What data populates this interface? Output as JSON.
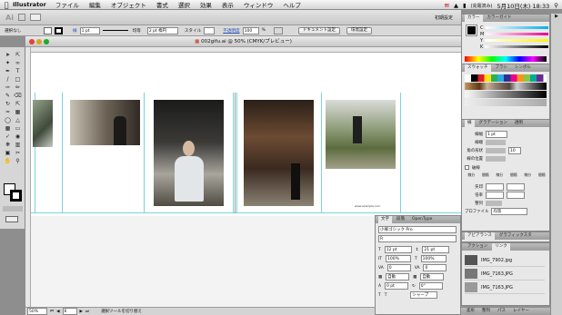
{
  "menubar": {
    "app": "Illustrator",
    "items": [
      "ファイル",
      "編集",
      "オブジェクト",
      "書式",
      "選択",
      "効果",
      "表示",
      "ウィンドウ",
      "ヘルプ"
    ],
    "status": "(充電済み)",
    "date": "5月10日(木) 18:33"
  },
  "appbar": {
    "logo": "Ai",
    "workspace": "初期設定"
  },
  "ctrlbar": {
    "selection": "選択なし",
    "stroke_label": "線",
    "stroke_value": "1 pt",
    "profile": "均等",
    "brush": "2 pt 楕円",
    "style_label": "スタイル",
    "opacity_label": "不透明度",
    "opacity_value": "100",
    "unit": "%",
    "doc_settings": "ドキュメント設定",
    "env_settings": "環境設定"
  },
  "document": {
    "title": "002gifu.ai @ 50% (CMYK/プレビュー)"
  },
  "canvas": {
    "footer_text": "www.example.com"
  },
  "status": {
    "zoom": "50%",
    "page": "6",
    "tool": "選択ツールを切り替え"
  },
  "color_panel": {
    "tabs": [
      "カラー",
      "カラーガイド"
    ],
    "channels": [
      "C",
      "M",
      "Y",
      "K"
    ]
  },
  "swatch_panel": {
    "tabs": [
      "スウォッチ",
      "ブラシ",
      "シンボル"
    ]
  },
  "stroke_panel": {
    "tabs": [
      "線",
      "グラデーション",
      "透明"
    ],
    "labels": [
      "線幅",
      "線端",
      "角の形状",
      "線の位置",
      "破線"
    ],
    "width": "1 pt",
    "limit": "10",
    "dash_labels": [
      "線分",
      "間隔",
      "線分",
      "間隔",
      "線分",
      "間隔"
    ],
    "arrow_labels": [
      "矢印",
      "倍率",
      "整列"
    ],
    "profile_label": "プロファイル",
    "profile_value": "均等"
  },
  "type_panel": {
    "tabs": [
      "文字",
      "段落",
      "OpenType"
    ],
    "font": "小塚ゴシック Pro",
    "style": "R",
    "size": "12 pt",
    "leading": "21 pt",
    "h_scale": "100%",
    "v_scale": "100%",
    "tracking": "0",
    "kerning": "自動",
    "baseline": "0 pt",
    "rotation": "0°",
    "aki": "0",
    "auto": "自動",
    "sharp": "シャープ"
  },
  "appearance_panel": {
    "tabs": [
      "アピアランス",
      "グラフィックスタ"
    ]
  },
  "links_panel": {
    "tabs": [
      "アクション",
      "リンク"
    ],
    "items": [
      "IMG_7902.jpg",
      "IMG_7163.JPG",
      "IMG_7163.JPG"
    ]
  },
  "bottom_tabs": [
    "変形",
    "整列",
    "パス",
    "レイヤー"
  ]
}
